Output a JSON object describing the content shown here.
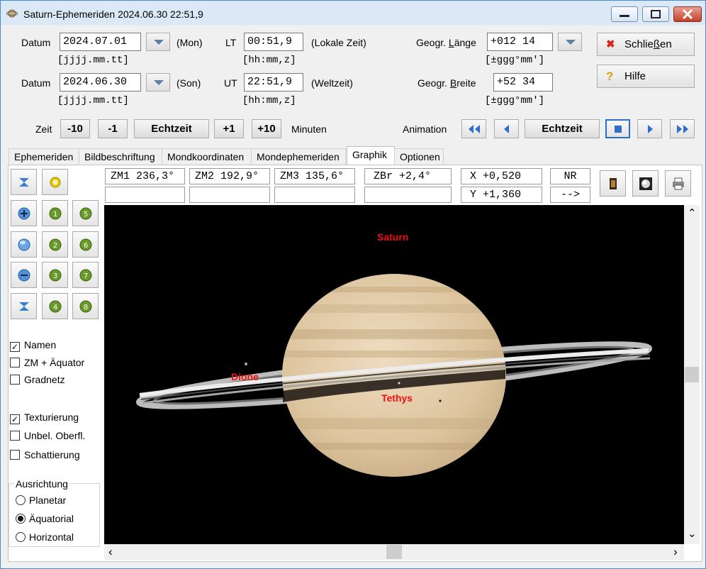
{
  "window": {
    "title": "Saturn-Ephemeriden  2024.06.30  22:51,9",
    "minimize_label": "minimize",
    "maximize_label": "maximize",
    "close_label": "close"
  },
  "inputs": {
    "datum_label": "Datum",
    "date1_value": "2024.07.01",
    "date1_weekday": "(Mon)",
    "date2_value": "2024.06.30",
    "date2_weekday": "(Son)",
    "date_format": "[jjjj.mm.tt]",
    "lt_label": "LT",
    "lt_value": "00:51,9",
    "lt_desc": "(Lokale Zeit)",
    "ut_label": "UT",
    "ut_value": "22:51,9",
    "ut_desc": "(Weltzeit)",
    "time_format": "[hh:mm,z]",
    "laenge_label_pre": "Geogr. ",
    "laenge_label_u": "L",
    "laenge_label_post": "änge",
    "laenge_value": "+012 14",
    "breite_label_pre": "Geogr. ",
    "breite_label_u": "B",
    "breite_label_post": "reite",
    "breite_value": "+52 34",
    "geo_format": "[±ggg°mm']"
  },
  "actions": {
    "close_pre": "Schlie",
    "close_u": "ß",
    "close_post": "en",
    "help_label": "Hilfe",
    "close_icon": "✖",
    "help_icon": "?"
  },
  "time_controls": {
    "label": "Zeit",
    "minus10": "-10",
    "minus1": "-1",
    "realtime": "Echtzeit",
    "plus1": "+1",
    "plus10": "+10",
    "unit": "Minuten",
    "animation_label": "Animation",
    "anim_realtime": "Echtzeit"
  },
  "tabs": [
    {
      "label": "Ephemeriden"
    },
    {
      "label": "Bildbeschriftung"
    },
    {
      "label": "Mondkoordinaten"
    },
    {
      "label": "Mondephemeriden"
    },
    {
      "label": "Graphik"
    },
    {
      "label": "Optionen"
    }
  ],
  "info": {
    "zm1": "ZM1 236,3°",
    "zm2": "ZM2 192,9°",
    "zm3": "ZM3 135,6°",
    "zbr": "ZBr  +2,4°",
    "x": "X  +0,520",
    "y": "Y  +1,360",
    "nr": "NR",
    "arrow": "-->"
  },
  "options": {
    "namen": "Namen",
    "zm_aequator": "ZM + Äquator",
    "gradnetz": "Gradnetz",
    "texturierung": "Texturierung",
    "unbel": "Unbel. Oberfl.",
    "schattierung": "Schattierung",
    "namen_checked": true,
    "zm_checked": false,
    "gradnetz_checked": false,
    "textur_checked": true,
    "unbel_checked": false,
    "schatt_checked": false,
    "check_mark": "✓"
  },
  "orientation": {
    "title": "Ausrichtung",
    "planetar": "Planetar",
    "aequatorial": "Äquatorial",
    "horizontal": "Horizontal",
    "selected": "aequatorial"
  },
  "zoom_presets": [
    "1",
    "2",
    "3",
    "4",
    "5",
    "6",
    "7",
    "8"
  ],
  "view": {
    "planet_label": "Saturn",
    "moons": [
      {
        "name": "Dione"
      },
      {
        "name": "Tethys"
      }
    ],
    "label_color": "#ee1111",
    "background": "#000000"
  },
  "scroll": {
    "up": "⌃",
    "down": "⌄",
    "left": "‹",
    "right": "›"
  }
}
